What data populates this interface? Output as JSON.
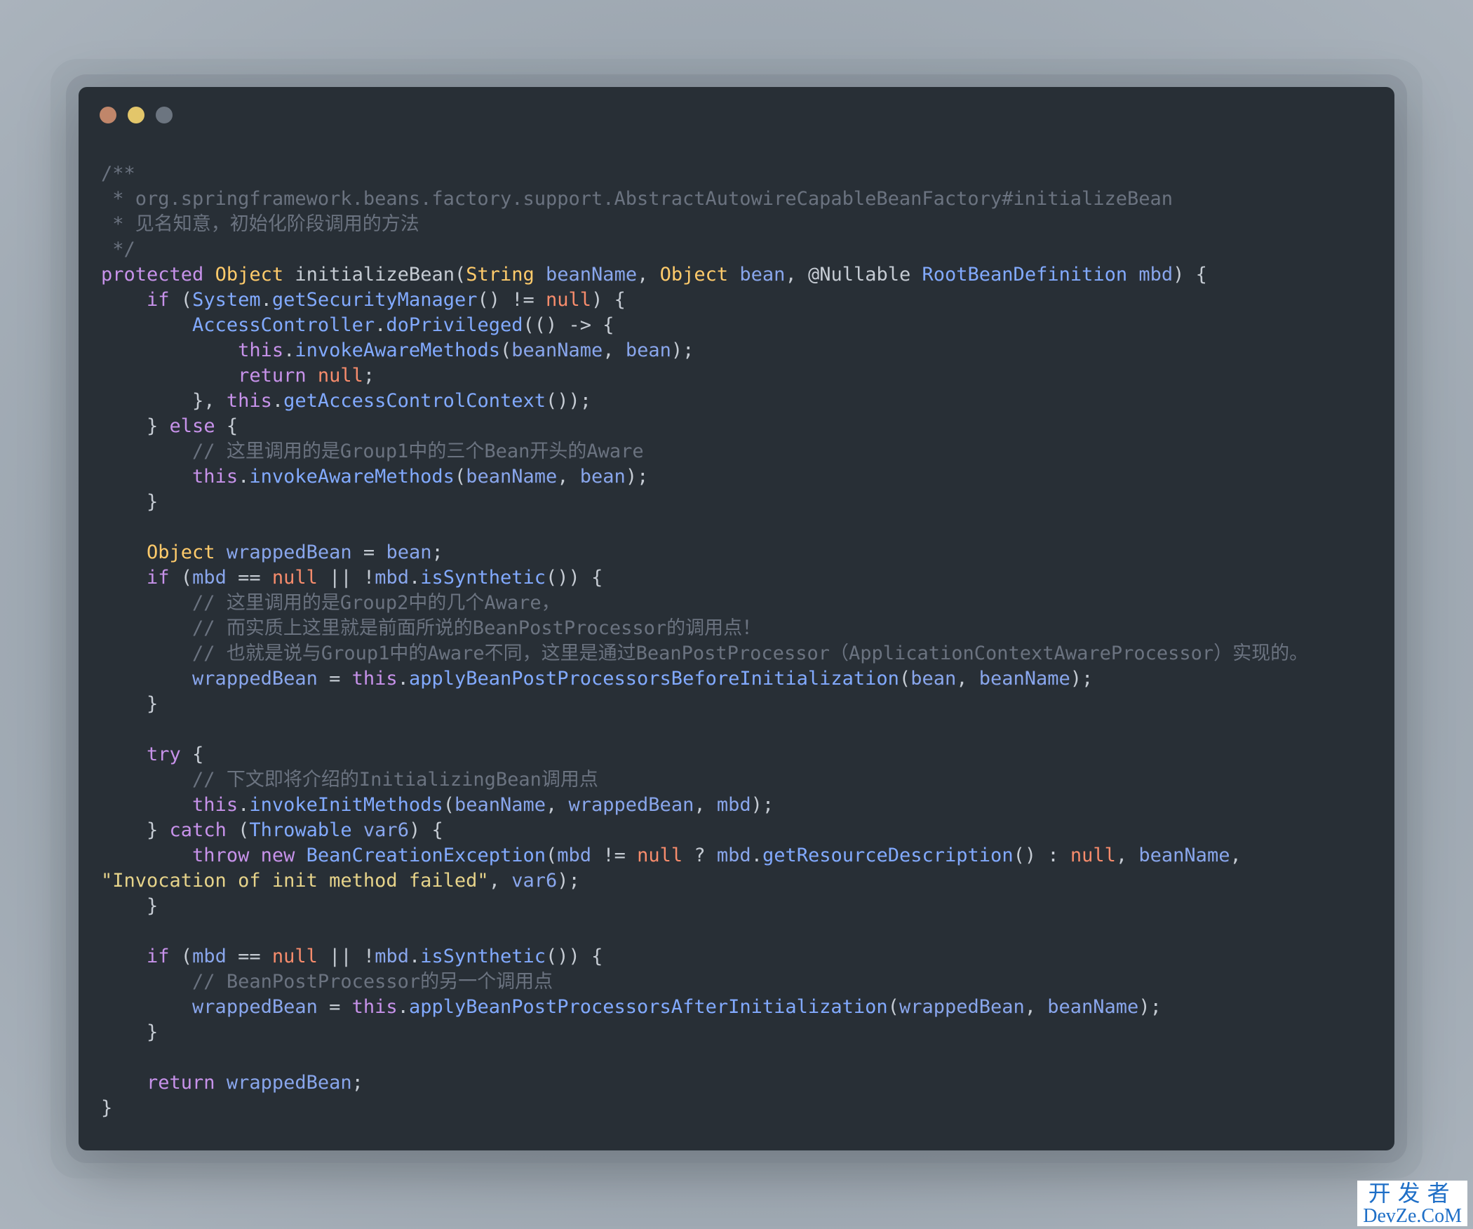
{
  "window": {
    "traffic_lights": [
      {
        "name": "close",
        "color": "#c0866a"
      },
      {
        "name": "minimize",
        "color": "#e3c66a"
      },
      {
        "name": "zoom",
        "color": "#6c7580"
      }
    ]
  },
  "code_lines": [
    [
      [
        "cm",
        "/**"
      ]
    ],
    [
      [
        "cm",
        " * org.springframework.beans.factory.support.AbstractAutowireCapableBeanFactory#initializeBean"
      ]
    ],
    [
      [
        "cm",
        " * 见名知意，初始化阶段调用的方法"
      ]
    ],
    [
      [
        "cm",
        " */"
      ]
    ],
    [
      [
        "kw",
        "protected"
      ],
      [
        "pl",
        " "
      ],
      [
        "ty",
        "Object"
      ],
      [
        "pl",
        " initializeBean("
      ],
      [
        "ty",
        "String"
      ],
      [
        "pl",
        " "
      ],
      [
        "vr",
        "beanName"
      ],
      [
        "pl",
        ", "
      ],
      [
        "ty",
        "Object"
      ],
      [
        "pl",
        " "
      ],
      [
        "vr",
        "bean"
      ],
      [
        "pl",
        ", @Nullable "
      ],
      [
        "fn",
        "RootBeanDefinition"
      ],
      [
        "pl",
        " "
      ],
      [
        "vr",
        "mbd"
      ],
      [
        "pl",
        ") {"
      ]
    ],
    [
      [
        "pl",
        "    "
      ],
      [
        "kw",
        "if"
      ],
      [
        "pl",
        " ("
      ],
      [
        "fn",
        "System"
      ],
      [
        "pl",
        "."
      ],
      [
        "fn",
        "getSecurityManager"
      ],
      [
        "pl",
        "() != "
      ],
      [
        "nl",
        "null"
      ],
      [
        "pl",
        ") {"
      ]
    ],
    [
      [
        "pl",
        "        "
      ],
      [
        "fn",
        "AccessController"
      ],
      [
        "pl",
        "."
      ],
      [
        "fn",
        "doPrivileged"
      ],
      [
        "pl",
        "(() -> {"
      ]
    ],
    [
      [
        "pl",
        "            "
      ],
      [
        "kw",
        "this"
      ],
      [
        "pl",
        "."
      ],
      [
        "fn",
        "invokeAwareMethods"
      ],
      [
        "pl",
        "("
      ],
      [
        "vr",
        "beanName"
      ],
      [
        "pl",
        ", "
      ],
      [
        "vr",
        "bean"
      ],
      [
        "pl",
        ");"
      ]
    ],
    [
      [
        "pl",
        "            "
      ],
      [
        "kw",
        "return"
      ],
      [
        "pl",
        " "
      ],
      [
        "nl",
        "null"
      ],
      [
        "pl",
        ";"
      ]
    ],
    [
      [
        "pl",
        "        }, "
      ],
      [
        "kw",
        "this"
      ],
      [
        "pl",
        "."
      ],
      [
        "fn",
        "getAccessControlContext"
      ],
      [
        "pl",
        "());"
      ]
    ],
    [
      [
        "pl",
        "    } "
      ],
      [
        "kw",
        "else"
      ],
      [
        "pl",
        " {"
      ]
    ],
    [
      [
        "pl",
        "        "
      ],
      [
        "cm",
        "// 这里调用的是Group1中的三个Bean开头的Aware"
      ]
    ],
    [
      [
        "pl",
        "        "
      ],
      [
        "kw",
        "this"
      ],
      [
        "pl",
        "."
      ],
      [
        "fn",
        "invokeAwareMethods"
      ],
      [
        "pl",
        "("
      ],
      [
        "vr",
        "beanName"
      ],
      [
        "pl",
        ", "
      ],
      [
        "vr",
        "bean"
      ],
      [
        "pl",
        ");"
      ]
    ],
    [
      [
        "pl",
        "    }"
      ]
    ],
    [
      [
        "pl",
        ""
      ]
    ],
    [
      [
        "pl",
        "    "
      ],
      [
        "ty",
        "Object"
      ],
      [
        "pl",
        " "
      ],
      [
        "vr",
        "wrappedBean"
      ],
      [
        "pl",
        " = "
      ],
      [
        "vr",
        "bean"
      ],
      [
        "pl",
        ";"
      ]
    ],
    [
      [
        "pl",
        "    "
      ],
      [
        "kw",
        "if"
      ],
      [
        "pl",
        " ("
      ],
      [
        "vr",
        "mbd"
      ],
      [
        "pl",
        " == "
      ],
      [
        "nl",
        "null"
      ],
      [
        "pl",
        " || !"
      ],
      [
        "vr",
        "mbd"
      ],
      [
        "pl",
        "."
      ],
      [
        "fn",
        "isSynthetic"
      ],
      [
        "pl",
        "()) {"
      ]
    ],
    [
      [
        "pl",
        "        "
      ],
      [
        "cm",
        "// 这里调用的是Group2中的几个Aware，"
      ]
    ],
    [
      [
        "pl",
        "        "
      ],
      [
        "cm",
        "// 而实质上这里就是前面所说的BeanPostProcessor的调用点！"
      ]
    ],
    [
      [
        "pl",
        "        "
      ],
      [
        "cm",
        "// 也就是说与Group1中的Aware不同，这里是通过BeanPostProcessor（ApplicationContextAwareProcessor）实现的。"
      ]
    ],
    [
      [
        "pl",
        "        "
      ],
      [
        "vr",
        "wrappedBean"
      ],
      [
        "pl",
        " = "
      ],
      [
        "kw",
        "this"
      ],
      [
        "pl",
        "."
      ],
      [
        "fn",
        "applyBeanPostProcessorsBeforeInitialization"
      ],
      [
        "pl",
        "("
      ],
      [
        "vr",
        "bean"
      ],
      [
        "pl",
        ", "
      ],
      [
        "vr",
        "beanName"
      ],
      [
        "pl",
        ");"
      ]
    ],
    [
      [
        "pl",
        "    }"
      ]
    ],
    [
      [
        "pl",
        ""
      ]
    ],
    [
      [
        "pl",
        "    "
      ],
      [
        "kw",
        "try"
      ],
      [
        "pl",
        " {"
      ]
    ],
    [
      [
        "pl",
        "        "
      ],
      [
        "cm",
        "// 下文即将介绍的InitializingBean调用点"
      ]
    ],
    [
      [
        "pl",
        "        "
      ],
      [
        "kw",
        "this"
      ],
      [
        "pl",
        "."
      ],
      [
        "fn",
        "invokeInitMethods"
      ],
      [
        "pl",
        "("
      ],
      [
        "vr",
        "beanName"
      ],
      [
        "pl",
        ", "
      ],
      [
        "vr",
        "wrappedBean"
      ],
      [
        "pl",
        ", "
      ],
      [
        "vr",
        "mbd"
      ],
      [
        "pl",
        ");"
      ]
    ],
    [
      [
        "pl",
        "    } "
      ],
      [
        "kw",
        "catch"
      ],
      [
        "pl",
        " ("
      ],
      [
        "fn",
        "Throwable"
      ],
      [
        "pl",
        " "
      ],
      [
        "vr",
        "var6"
      ],
      [
        "pl",
        ") {"
      ]
    ],
    [
      [
        "pl",
        "        "
      ],
      [
        "kw",
        "throw"
      ],
      [
        "pl",
        " "
      ],
      [
        "kw",
        "new"
      ],
      [
        "pl",
        " "
      ],
      [
        "fn",
        "BeanCreationException"
      ],
      [
        "pl",
        "("
      ],
      [
        "vr",
        "mbd"
      ],
      [
        "pl",
        " != "
      ],
      [
        "nl",
        "null"
      ],
      [
        "pl",
        " ? "
      ],
      [
        "vr",
        "mbd"
      ],
      [
        "pl",
        "."
      ],
      [
        "fn",
        "getResourceDescription"
      ],
      [
        "pl",
        "() : "
      ],
      [
        "nl",
        "null"
      ],
      [
        "pl",
        ", "
      ],
      [
        "vr",
        "beanName"
      ],
      [
        "pl",
        ","
      ]
    ],
    [
      [
        "st2",
        "\"Invocation of init method failed\""
      ],
      [
        "pl",
        ", "
      ],
      [
        "vr",
        "var6"
      ],
      [
        "pl",
        ");"
      ]
    ],
    [
      [
        "pl",
        "    }"
      ]
    ],
    [
      [
        "pl",
        ""
      ]
    ],
    [
      [
        "pl",
        "    "
      ],
      [
        "kw",
        "if"
      ],
      [
        "pl",
        " ("
      ],
      [
        "vr",
        "mbd"
      ],
      [
        "pl",
        " == "
      ],
      [
        "nl",
        "null"
      ],
      [
        "pl",
        " || !"
      ],
      [
        "vr",
        "mbd"
      ],
      [
        "pl",
        "."
      ],
      [
        "fn",
        "isSynthetic"
      ],
      [
        "pl",
        "()) {"
      ]
    ],
    [
      [
        "pl",
        "        "
      ],
      [
        "cm",
        "// BeanPostProcessor的另一个调用点"
      ]
    ],
    [
      [
        "pl",
        "        "
      ],
      [
        "vr",
        "wrappedBean"
      ],
      [
        "pl",
        " = "
      ],
      [
        "kw",
        "this"
      ],
      [
        "pl",
        "."
      ],
      [
        "fn",
        "applyBeanPostProcessorsAfterInitialization"
      ],
      [
        "pl",
        "("
      ],
      [
        "vr",
        "wrappedBean"
      ],
      [
        "pl",
        ", "
      ],
      [
        "vr",
        "beanName"
      ],
      [
        "pl",
        ");"
      ]
    ],
    [
      [
        "pl",
        "    }"
      ]
    ],
    [
      [
        "pl",
        ""
      ]
    ],
    [
      [
        "pl",
        "    "
      ],
      [
        "kw",
        "return"
      ],
      [
        "pl",
        " "
      ],
      [
        "vr",
        "wrappedBean"
      ],
      [
        "pl",
        ";"
      ]
    ],
    [
      [
        "pl",
        "}"
      ]
    ]
  ],
  "watermark": {
    "line1": "开发者",
    "line2": "DevZe.CoM"
  }
}
